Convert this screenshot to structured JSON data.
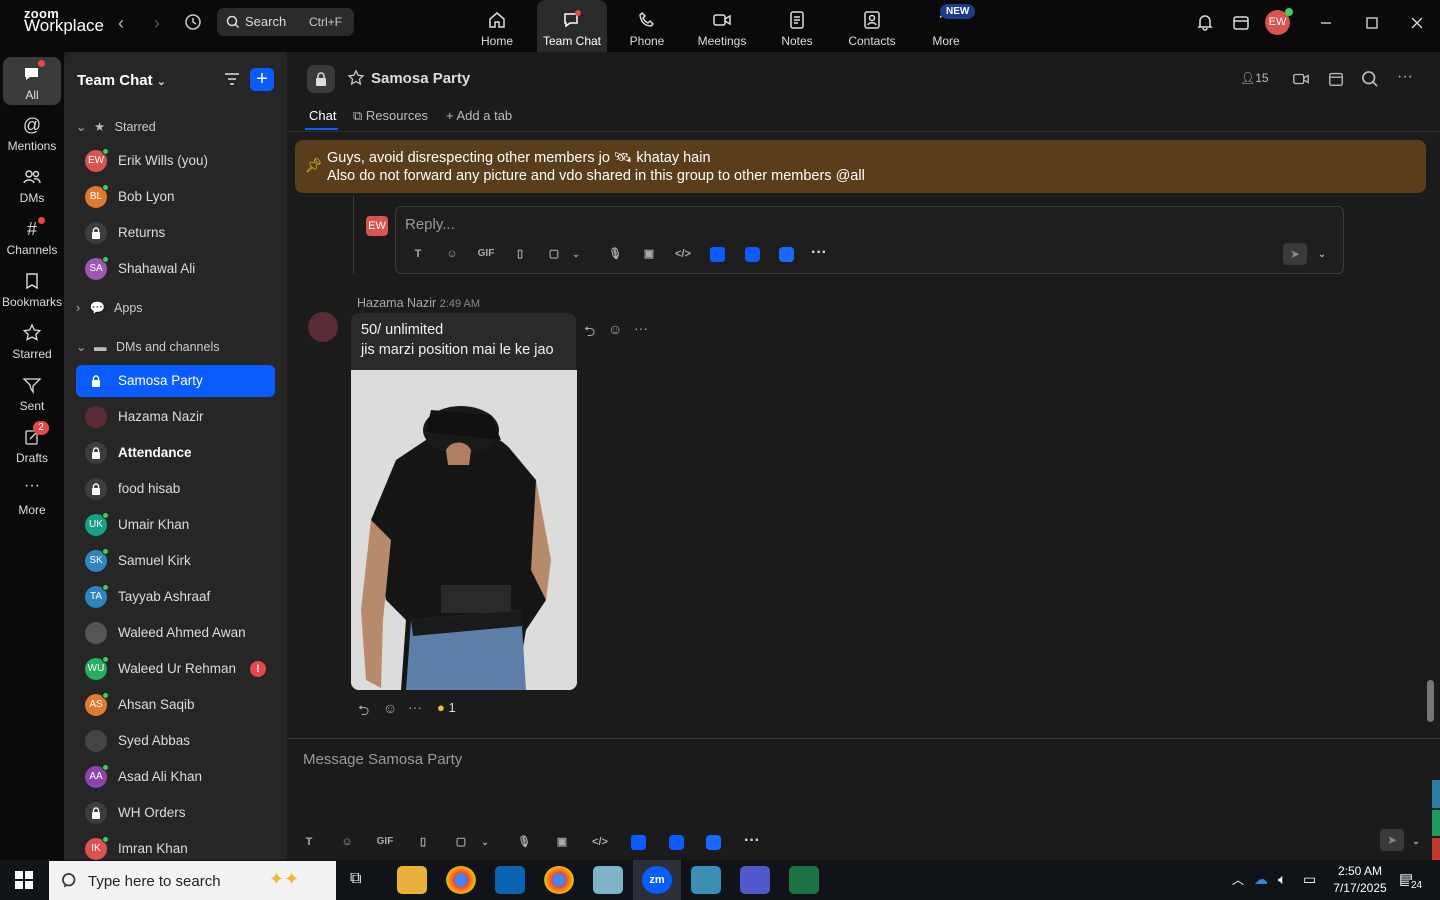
{
  "app": {
    "logo_top": "zoom",
    "logo_bottom": "Workplace"
  },
  "search": {
    "label": "Search",
    "shortcut": "Ctrl+F"
  },
  "topnav": [
    {
      "label": "Home",
      "icon": "home-icon"
    },
    {
      "label": "Team Chat",
      "icon": "chat-icon",
      "active": true
    },
    {
      "label": "Phone",
      "icon": "phone-icon"
    },
    {
      "label": "Meetings",
      "icon": "video-icon"
    },
    {
      "label": "Notes",
      "icon": "notes-icon"
    },
    {
      "label": "Contacts",
      "icon": "contacts-icon"
    },
    {
      "label": "More",
      "icon": "more-icon"
    }
  ],
  "new_badge": "NEW",
  "user_initials": "EW",
  "rail": [
    {
      "label": "All",
      "active": true
    },
    {
      "label": "Mentions"
    },
    {
      "label": "DMs"
    },
    {
      "label": "Channels"
    },
    {
      "label": "Bookmarks"
    },
    {
      "label": "Starred"
    },
    {
      "label": "Sent"
    },
    {
      "label": "Drafts",
      "badge": "2"
    },
    {
      "label": "More"
    }
  ],
  "sidebar": {
    "title": "Team Chat",
    "sections": {
      "starred": "Starred",
      "apps": "Apps",
      "dms": "DMs and channels"
    },
    "starred_items": [
      {
        "name": "Erik Wills (you)",
        "initials": "EW",
        "color": "#d9534f"
      },
      {
        "name": "Bob Lyon",
        "initials": "BL",
        "color": "#e07a2f"
      },
      {
        "name": "Returns",
        "initials": "",
        "color": "#3d3d3d"
      },
      {
        "name": "Shahawal Ali",
        "initials": "SA",
        "color": "#9b59b6"
      }
    ],
    "dm_items": [
      {
        "name": "Samosa Party",
        "initials": "",
        "color": "#0b5cff"
      },
      {
        "name": "Hazama Nazir",
        "initials": "",
        "color": "#5a2a35"
      },
      {
        "name": "Attendance",
        "initials": "",
        "color": "#3d3d3d"
      },
      {
        "name": "food hisab",
        "initials": "",
        "color": "#3d3d3d"
      },
      {
        "name": "Umair Khan",
        "initials": "UK",
        "color": "#16a085"
      },
      {
        "name": "Samuel Kirk",
        "initials": "SK",
        "color": "#2e86c1"
      },
      {
        "name": "Tayyab Ashraaf",
        "initials": "TA",
        "color": "#2e86c1"
      },
      {
        "name": "Waleed Ahmed Awan",
        "initials": "",
        "color": "#555555"
      },
      {
        "name": "Waleed Ur Rehman",
        "initials": "WU",
        "color": "#27ae60",
        "alert": "!"
      },
      {
        "name": "Ahsan Saqib",
        "initials": "AS",
        "color": "#e07a2f"
      },
      {
        "name": "Syed Abbas",
        "initials": "",
        "color": "#444444"
      },
      {
        "name": "Asad Ali Khan",
        "initials": "AA",
        "color": "#8e44ad"
      },
      {
        "name": "WH Orders",
        "initials": "",
        "color": "#3d3d3d"
      },
      {
        "name": "Imran Khan",
        "initials": "IK",
        "color": "#d9534f"
      }
    ]
  },
  "channel": {
    "name": "Samosa Party",
    "members": "15",
    "tabs": [
      "Chat",
      "Resources",
      "Add a tab"
    ]
  },
  "pinned": {
    "line1": "Guys, avoid disrespecting other members jo 🛰 khatay hain",
    "line2": "Also do not forward any picture and vdo shared in this group to other members @all"
  },
  "reply": {
    "placeholder": "Reply...",
    "avatar": "EW"
  },
  "message": {
    "sender": "Hazama Nazir",
    "time": "2:49 AM",
    "line1": "50/ unlimited",
    "line2": "jis marzi position mai le ke jao",
    "reaction_count": "1"
  },
  "composer": {
    "placeholder": "Message Samosa Party"
  },
  "toolbar": {
    "gif": "GIF"
  },
  "taskbar": {
    "search_placeholder": "Type here to search",
    "time": "2:50 AM",
    "date": "7/17/2025",
    "notif_count": "24"
  }
}
